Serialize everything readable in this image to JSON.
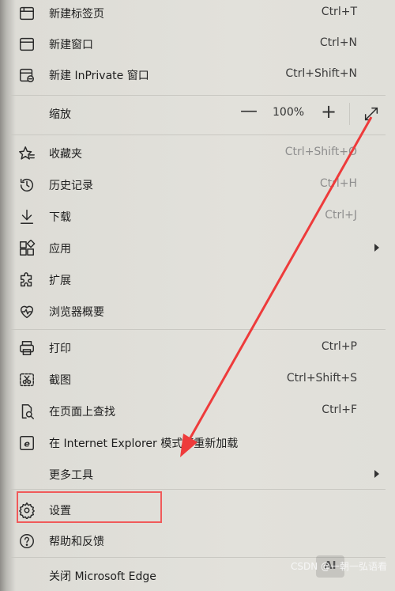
{
  "menu": {
    "new_tab": {
      "label": "新建标签页",
      "shortcut": "Ctrl+T"
    },
    "new_window": {
      "label": "新建窗口",
      "shortcut": "Ctrl+N"
    },
    "new_inprivate": {
      "label": "新建 InPrivate 窗口",
      "shortcut": "Ctrl+Shift+N"
    },
    "zoom": {
      "label": "缩放",
      "minus": "—",
      "value": "100%",
      "plus": "+"
    },
    "favorites": {
      "label": "收藏夹",
      "shortcut": "Ctrl+Shift+O"
    },
    "history": {
      "label": "历史记录",
      "shortcut": "Ctrl+H"
    },
    "downloads": {
      "label": "下载",
      "shortcut": "Ctrl+J"
    },
    "apps": {
      "label": "应用"
    },
    "extensions": {
      "label": "扩展"
    },
    "browser_essentials": {
      "label": "浏览器概要"
    },
    "print": {
      "label": "打印",
      "shortcut": "Ctrl+P"
    },
    "screenshot": {
      "label": "截图",
      "shortcut": "Ctrl+Shift+S"
    },
    "find": {
      "label": "在页面上查找",
      "shortcut": "Ctrl+F"
    },
    "ie_mode": {
      "label": "在 Internet Explorer 模式下重新加载"
    },
    "more_tools": {
      "label": "更多工具"
    },
    "settings": {
      "label": "设置"
    },
    "help": {
      "label": "帮助和反馈"
    },
    "close_edge": {
      "label": "关闭 Microsoft Edge"
    }
  },
  "watermark": {
    "text": "CSDN @一朝一弘语看",
    "logo": "AI"
  },
  "colors": {
    "highlight": "#f05a5a",
    "arrow": "#ee3b3b"
  }
}
